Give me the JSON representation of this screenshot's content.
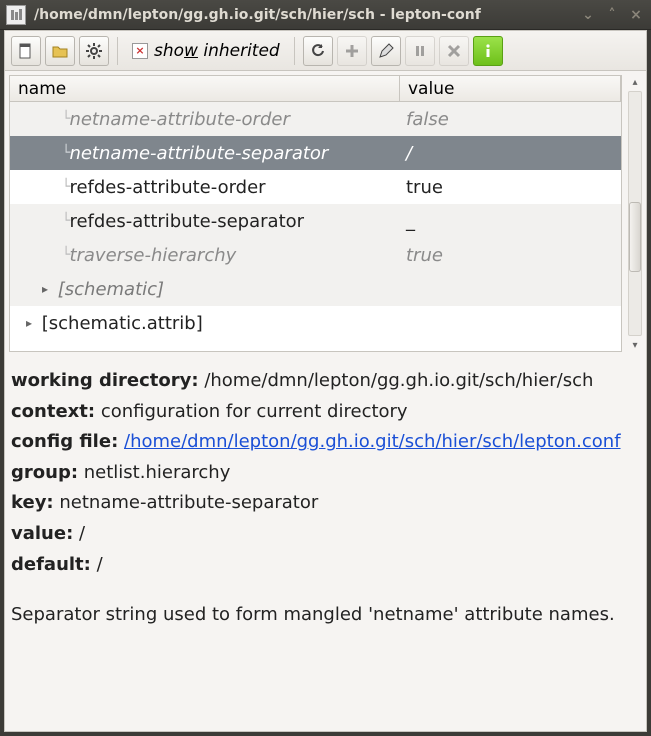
{
  "window": {
    "title": "/home/dmn/lepton/gg.gh.io.git/sch/hier/sch - lepton-conf"
  },
  "toolbar": {
    "show_inherited_label_pre": "sho",
    "show_inherited_label_u": "w",
    "show_inherited_label_post": " inherited"
  },
  "tree": {
    "header_name": "name",
    "header_value": "value",
    "rows": [
      {
        "name": "netname-attribute-order",
        "value": "false",
        "inherited": true
      },
      {
        "name": "netname-attribute-separator",
        "value": "/",
        "inherited": true,
        "selected": true
      },
      {
        "name": "refdes-attribute-order",
        "value": "true",
        "inherited": false
      },
      {
        "name": "refdes-attribute-separator",
        "value": "_",
        "inherited": false
      },
      {
        "name": "traverse-hierarchy",
        "value": "true",
        "inherited": true
      }
    ],
    "groups": [
      {
        "label": "[schematic]",
        "expandable": true,
        "inherited": true
      },
      {
        "label": "[schematic.attrib]",
        "expandable": true,
        "inherited": false
      }
    ]
  },
  "info": {
    "wd_label": "working directory:",
    "wd_value": "/home/dmn/lepton/gg.gh.io.git/sch/hier/sch",
    "ctx_label": "context:",
    "ctx_value": "configuration for current directory",
    "cfg_label": "config file:",
    "cfg_link": "/home/dmn/lepton/gg.gh.io.git/sch/hier/sch/lepton.conf",
    "group_label": "group:",
    "group_value": "netlist.hierarchy",
    "key_label": "key:",
    "key_value": "netname-attribute-separator",
    "val_label": "value:",
    "val_value": "/",
    "def_label": "default:",
    "def_value": "/",
    "description": "Separator string used to form mangled 'netname' attribute names."
  }
}
